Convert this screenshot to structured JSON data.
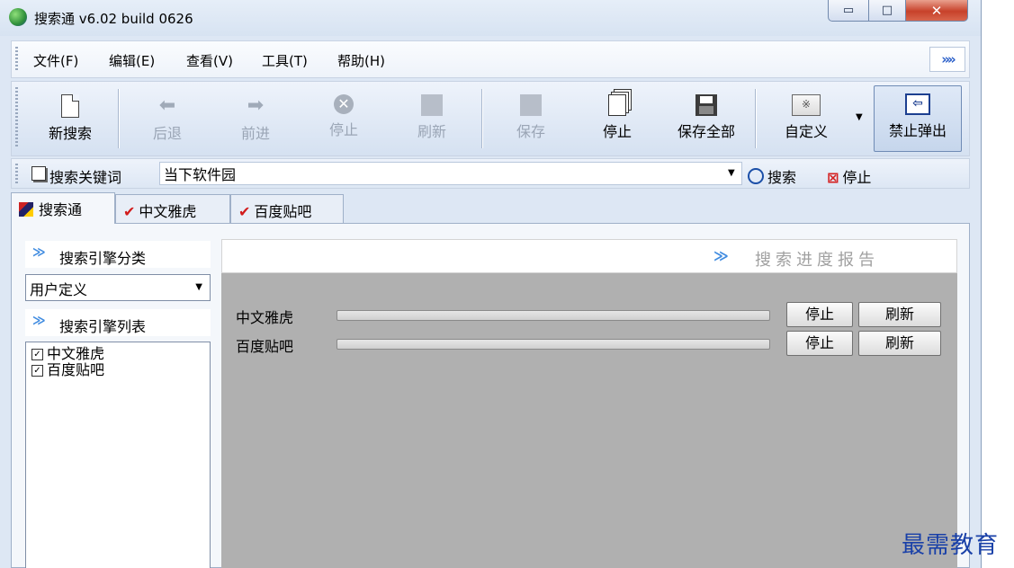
{
  "window": {
    "title": "搜索通 v6.02 build 0626",
    "controls": {
      "minimize": "▭",
      "maximize": "□",
      "close": "✕"
    }
  },
  "menu": {
    "items": [
      "文件(F)",
      "编辑(E)",
      "查看(V)",
      "工具(T)",
      "帮助(H)"
    ],
    "overflow": "»"
  },
  "toolbar": {
    "buttons": [
      {
        "label": "新搜索",
        "icon": "new-document-icon",
        "enabled": true
      },
      {
        "label": "后退",
        "icon": "back-arrow-icon",
        "enabled": false
      },
      {
        "label": "前进",
        "icon": "forward-arrow-icon",
        "enabled": false
      },
      {
        "label": "停止",
        "icon": "stop-icon",
        "enabled": false
      },
      {
        "label": "刷新",
        "icon": "refresh-icon",
        "enabled": false
      },
      {
        "label": "保存",
        "icon": "save-icon",
        "enabled": false
      },
      {
        "label": "停止",
        "icon": "stop-all-icon",
        "enabled": true
      },
      {
        "label": "保存全部",
        "icon": "save-all-icon",
        "enabled": true
      },
      {
        "label": "自定义",
        "icon": "custom-icon",
        "enabled": true
      },
      {
        "label": "禁止弹出",
        "icon": "block-popup-icon",
        "enabled": true,
        "pressed": true
      }
    ]
  },
  "search": {
    "label": "搜索关键词",
    "value": "当下软件园",
    "search_button": "搜索",
    "stop_button": "停止"
  },
  "tabs": [
    {
      "label": "搜索通",
      "active": true
    },
    {
      "label": "中文雅虎",
      "active": false
    },
    {
      "label": "百度贴吧",
      "active": false
    }
  ],
  "left": {
    "category_title": "搜索引擎分类",
    "category_selected": "用户定义",
    "list_title": "搜索引擎列表",
    "engines": [
      {
        "name": "中文雅虎",
        "checked": true
      },
      {
        "name": "百度贴吧",
        "checked": true
      }
    ]
  },
  "report": {
    "title": "搜索进度报告",
    "rows": [
      {
        "name": "中文雅虎",
        "progress": 0,
        "stop": "停止",
        "refresh": "刷新"
      },
      {
        "name": "百度贴吧",
        "progress": 0,
        "stop": "停止",
        "refresh": "刷新"
      }
    ]
  },
  "watermark": "最需教育",
  "colors": {
    "accent": "#3f8be0",
    "close": "#c7412a",
    "report_bg": "#b0b0b0"
  }
}
